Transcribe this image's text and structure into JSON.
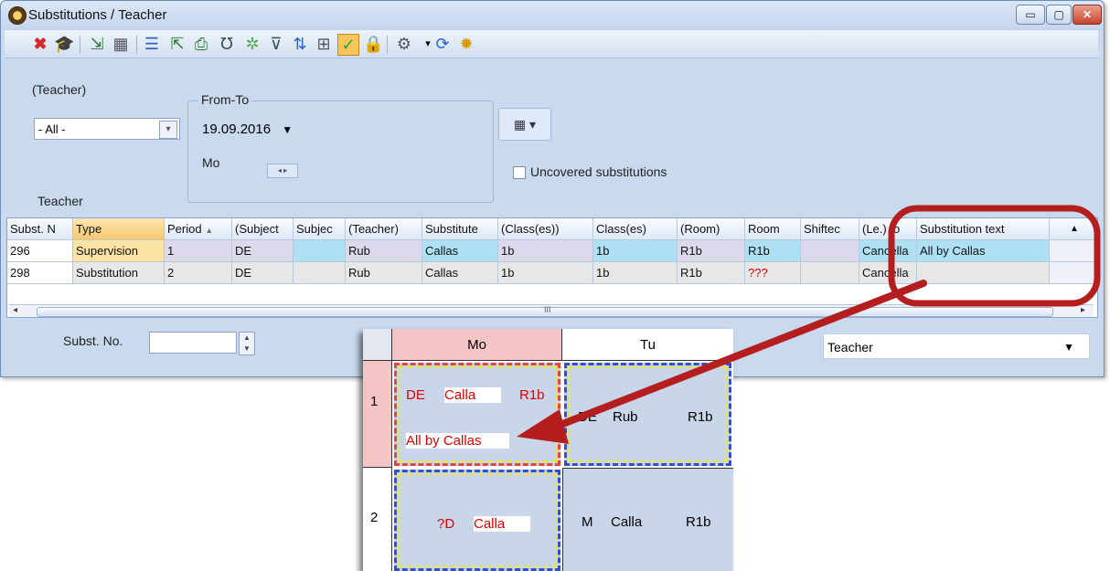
{
  "window": {
    "title": "Substitutions / Teacher",
    "min": "▭",
    "max": "▢",
    "close": "✕"
  },
  "toolbar": {
    "icons": [
      "delete-icon",
      "mortarboard-icon",
      "import-icon",
      "calculator-icon",
      "list-icon",
      "export-icon",
      "print-icon",
      "stethoscope-icon",
      "magic-icon",
      "filter-icon",
      "sort-icon",
      "table-icon",
      "check-icon",
      "lock-icon",
      "tools-icon",
      "refresh-icon",
      "gear-icon"
    ]
  },
  "filters": {
    "teacher_label": "(Teacher)",
    "teacher_value": "- All -",
    "fromto_label": "From-To",
    "date_value": "19.09.2016",
    "day_label": "Mo",
    "uncovered_label": "Uncovered substitutions",
    "teacher_section_label": "Teacher"
  },
  "grid": {
    "columns": [
      "Subst. N",
      "Type",
      "Period",
      "(Subject",
      "Subjec",
      "(Teacher)",
      "Substitute",
      "(Class(es))",
      "Class(es)",
      "(Room)",
      "Room",
      "Shiftec",
      "(Le.) to",
      "Substitution text"
    ],
    "rows": [
      [
        "296",
        "Supervision",
        "1",
        "DE",
        "",
        "Rub",
        "Callas",
        "1b",
        "1b",
        "R1b",
        "R1b",
        "",
        "Cancella",
        "All by Callas"
      ],
      [
        "298",
        "Substitution",
        "2",
        "DE",
        "",
        "Rub",
        "Callas",
        "1b",
        "1b",
        "R1b",
        "???",
        "",
        "Cancella",
        ""
      ]
    ],
    "scroll_marker": "III"
  },
  "status": {
    "subst_no_label": "Subst. No.",
    "view_value": "Teacher"
  },
  "timetable": {
    "days": [
      "Mo",
      "Tu"
    ],
    "periods": [
      "1",
      "2"
    ],
    "mo1": {
      "subject": "DE",
      "teacher": "Calla",
      "room": "R1b",
      "text": "All by Callas"
    },
    "tu1": {
      "subject": "DE",
      "teacher": "Rub",
      "room": "R1b"
    },
    "mo2": {
      "subject": "?D",
      "teacher": "Calla"
    },
    "tu2": {
      "subject": "M",
      "teacher": "Calla",
      "room": "R1b"
    }
  },
  "colors": {
    "accent_red": "#b51e1e",
    "selected_cell": "#fbe3a4",
    "row_highlight": "#d6e4f7"
  }
}
